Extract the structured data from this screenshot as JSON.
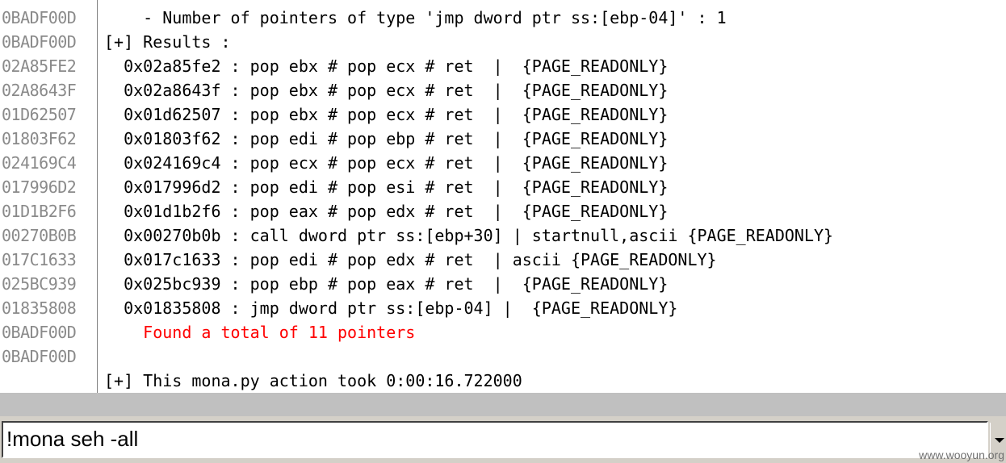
{
  "log": {
    "rows": [
      {
        "addr": "0BADF00D",
        "text": "    - Number of pointers of type 'jmp dword ptr ss:[ebp-04]' : 1",
        "color": "#000000"
      },
      {
        "addr": "0BADF00D",
        "text": "[+] Results :",
        "color": "#000000"
      },
      {
        "addr": "02A85FE2",
        "text": "  0x02a85fe2 : pop ebx # pop ecx # ret  |  {PAGE_READONLY}",
        "color": "#000000"
      },
      {
        "addr": "02A8643F",
        "text": "  0x02a8643f : pop ebx # pop ecx # ret  |  {PAGE_READONLY}",
        "color": "#000000"
      },
      {
        "addr": "01D62507",
        "text": "  0x01d62507 : pop ebx # pop ecx # ret  |  {PAGE_READONLY}",
        "color": "#000000"
      },
      {
        "addr": "01803F62",
        "text": "  0x01803f62 : pop edi # pop ebp # ret  |  {PAGE_READONLY}",
        "color": "#000000"
      },
      {
        "addr": "024169C4",
        "text": "  0x024169c4 : pop ecx # pop ecx # ret  |  {PAGE_READONLY}",
        "color": "#000000"
      },
      {
        "addr": "017996D2",
        "text": "  0x017996d2 : pop edi # pop esi # ret  |  {PAGE_READONLY}",
        "color": "#000000"
      },
      {
        "addr": "01D1B2F6",
        "text": "  0x01d1b2f6 : pop eax # pop edx # ret  |  {PAGE_READONLY}",
        "color": "#000000"
      },
      {
        "addr": "00270B0B",
        "text": "  0x00270b0b : call dword ptr ss:[ebp+30] | startnull,ascii {PAGE_READONLY}",
        "color": "#000000"
      },
      {
        "addr": "017C1633",
        "text": "  0x017c1633 : pop edi # pop edx # ret  | ascii {PAGE_READONLY}",
        "color": "#000000"
      },
      {
        "addr": "025BC939",
        "text": "  0x025bc939 : pop ebp # pop eax # ret  |  {PAGE_READONLY}",
        "color": "#000000"
      },
      {
        "addr": "01835808",
        "text": "  0x01835808 : jmp dword ptr ss:[ebp-04] |  {PAGE_READONLY}",
        "color": "#000000"
      },
      {
        "addr": "0BADF00D",
        "text": "    Found a total of 11 pointers",
        "color": "#ff0000"
      },
      {
        "addr": "0BADF00D",
        "text": "",
        "color": "#000000"
      },
      {
        "addr": "",
        "text": "[+] This mona.py action took 0:00:16.722000",
        "color": "#000000"
      }
    ]
  },
  "command": {
    "value": "!mona seh -all"
  },
  "watermark": "www.wooyun.org",
  "colors": {
    "address": "#8a8a8a",
    "highlight": "#ff0000",
    "background": "#ffffff",
    "chrome": "#d4d0c8"
  }
}
